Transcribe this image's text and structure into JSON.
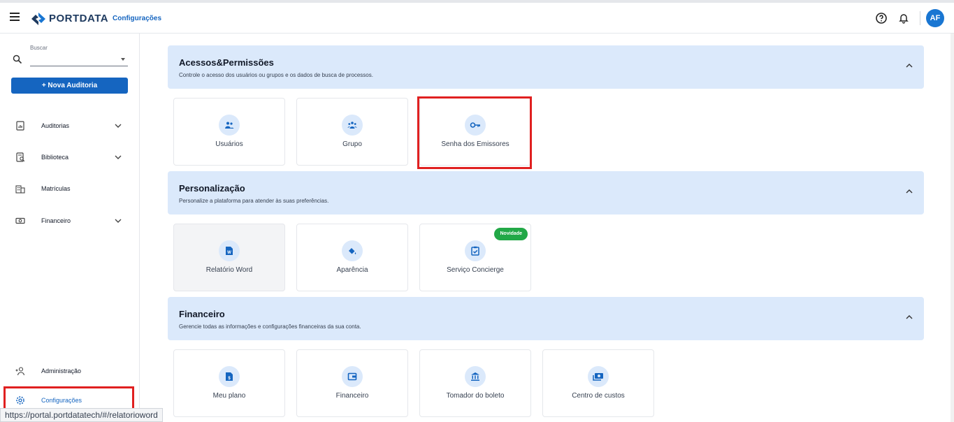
{
  "header": {
    "brand": "PORTDATA",
    "breadcrumb": "Configurações",
    "avatar_initials": "AF",
    "icons": [
      "menu-icon",
      "help-icon",
      "bell-icon"
    ]
  },
  "sidebar": {
    "search_label": "Buscar",
    "search_value": "",
    "new_audit_label": "+ Nova Auditoria",
    "items": [
      {
        "label": "Auditorias",
        "icon": "report-icon",
        "expandable": true
      },
      {
        "label": "Biblioteca",
        "icon": "library-icon",
        "expandable": true
      },
      {
        "label": "Matrículas",
        "icon": "building-icon",
        "expandable": false
      },
      {
        "label": "Financeiro",
        "icon": "money-icon",
        "expandable": true
      }
    ],
    "bottom_items": [
      {
        "label": "Administração",
        "icon": "person-add-icon"
      },
      {
        "label": "Configurações",
        "icon": "gear-icon",
        "active": true
      }
    ]
  },
  "status_bar_url": "https://portal.portdatatech/#/relatorioword",
  "sections": [
    {
      "title": "Acessos&Permissões",
      "description": "Controle o acesso dos usuários ou grupos e os dados de busca de processos.",
      "cards": [
        {
          "label": "Usuários",
          "icon": "users-icon"
        },
        {
          "label": "Grupo",
          "icon": "group-icon"
        },
        {
          "label": "Senha dos Emissores",
          "icon": "key-icon"
        }
      ]
    },
    {
      "title": "Personalização",
      "description": "Personalize a plataforma para atender às suas preferências.",
      "cards": [
        {
          "label": "Relatório Word",
          "icon": "word-doc-icon"
        },
        {
          "label": "Aparência",
          "icon": "paint-bucket-icon"
        },
        {
          "label": "Serviço Concierge",
          "icon": "clipboard-check-icon",
          "badge": "Novidade"
        }
      ]
    },
    {
      "title": "Financeiro",
      "description": "Gerencie todas as informações e configurações financeiras da sua conta.",
      "cards": [
        {
          "label": "Meu plano",
          "icon": "plan-doc-icon"
        },
        {
          "label": "Financeiro",
          "icon": "wallet-icon"
        },
        {
          "label": "Tomador do boleto",
          "icon": "bank-icon"
        },
        {
          "label": "Centro de custos",
          "icon": "cash-icon"
        }
      ]
    }
  ],
  "colors": {
    "primary": "#1565c0",
    "section_bg": "#dbe9fb",
    "highlight": "#e02020",
    "badge": "#22a847"
  }
}
